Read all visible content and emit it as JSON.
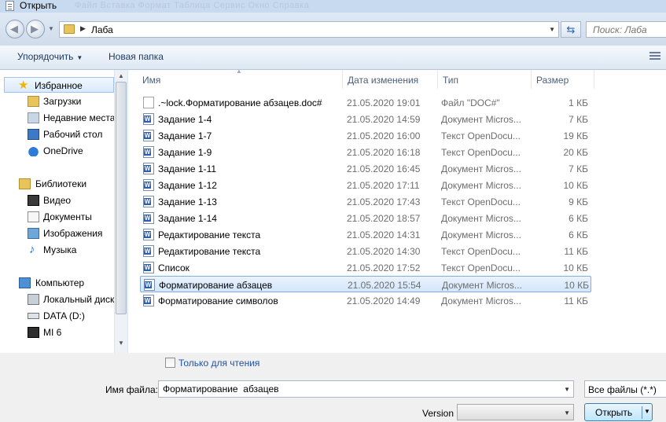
{
  "window": {
    "title": "Открыть",
    "ghost_menu": "Файл   Вставка   Формат   Таблица   Сервис   Окно   Справка"
  },
  "address": {
    "path": "Лаба",
    "search_placeholder": "Поиск: Лаба"
  },
  "toolbar": {
    "organize": "Упорядочить",
    "new_folder": "Новая папка"
  },
  "nav": {
    "favorites": "Избранное",
    "downloads": "Загрузки",
    "recent": "Недавние места",
    "desktop": "Рабочий стол",
    "onedrive": "OneDrive",
    "libraries": "Библиотеки",
    "video": "Видео",
    "documents": "Документы",
    "pictures": "Изображения",
    "music": "Музыка",
    "computer": "Компьютер",
    "local_disk": "Локальный диск",
    "data_d": "DATA (D:)",
    "mi6": "MI 6"
  },
  "columns": {
    "name": "Имя",
    "date": "Дата изменения",
    "type": "Тип",
    "size": "Размер"
  },
  "files": [
    {
      "name": ".~lock.Форматирование  абзацев.doc#",
      "date": "21.05.2020 19:01",
      "type": "Файл \"DOC#\"",
      "size": "1 КБ",
      "icon": "blank-file-icon"
    },
    {
      "name": "Задание 1-4",
      "date": "21.05.2020 14:59",
      "type": "Документ Micros...",
      "size": "7 КБ",
      "icon": "word-doc-icon"
    },
    {
      "name": "Задание 1-7",
      "date": "21.05.2020 16:00",
      "type": "Текст OpenDocu...",
      "size": "19 КБ",
      "icon": "word-doc-icon"
    },
    {
      "name": "Задание 1-9",
      "date": "21.05.2020 16:18",
      "type": "Текст OpenDocu...",
      "size": "20 КБ",
      "icon": "word-doc-icon"
    },
    {
      "name": "Задание 1-11",
      "date": "21.05.2020 16:45",
      "type": "Документ Micros...",
      "size": "7 КБ",
      "icon": "word-doc-icon"
    },
    {
      "name": "Задание 1-12",
      "date": "21.05.2020 17:11",
      "type": "Документ Micros...",
      "size": "10 КБ",
      "icon": "word-doc-icon"
    },
    {
      "name": "Задание 1-13",
      "date": "21.05.2020 17:43",
      "type": "Текст OpenDocu...",
      "size": "9 КБ",
      "icon": "word-doc-icon"
    },
    {
      "name": "Задание 1-14",
      "date": "21.05.2020 18:57",
      "type": "Документ Micros...",
      "size": "6 КБ",
      "icon": "word-doc-icon"
    },
    {
      "name": "Редактирование текста",
      "date": "21.05.2020 14:31",
      "type": "Документ Micros...",
      "size": "6 КБ",
      "icon": "word-doc-icon"
    },
    {
      "name": "Редактирование текста",
      "date": "21.05.2020 14:30",
      "type": "Текст OpenDocu...",
      "size": "11 КБ",
      "icon": "word-doc-icon"
    },
    {
      "name": "Список",
      "date": "21.05.2020 17:52",
      "type": "Текст OpenDocu...",
      "size": "10 КБ",
      "icon": "word-doc-icon"
    },
    {
      "name": "Форматирование  абзацев",
      "date": "21.05.2020 15:54",
      "type": "Документ Micros...",
      "size": "10 КБ",
      "icon": "word-doc-icon",
      "selected": true
    },
    {
      "name": "Форматирование символов",
      "date": "21.05.2020 14:49",
      "type": "Документ Micros...",
      "size": "11 КБ",
      "icon": "word-doc-icon"
    }
  ],
  "bottom": {
    "read_only": "Только для чтения",
    "file_name_label": "Имя файла:",
    "file_name_value": "Форматирование  абзацев",
    "filter": "Все файлы (*.*)",
    "version_label": "Version",
    "open": "Открыть"
  },
  "colors": {
    "accent": "#1c52a8",
    "selection": "#d3e6fb",
    "chrome": "#dbe6f3"
  }
}
